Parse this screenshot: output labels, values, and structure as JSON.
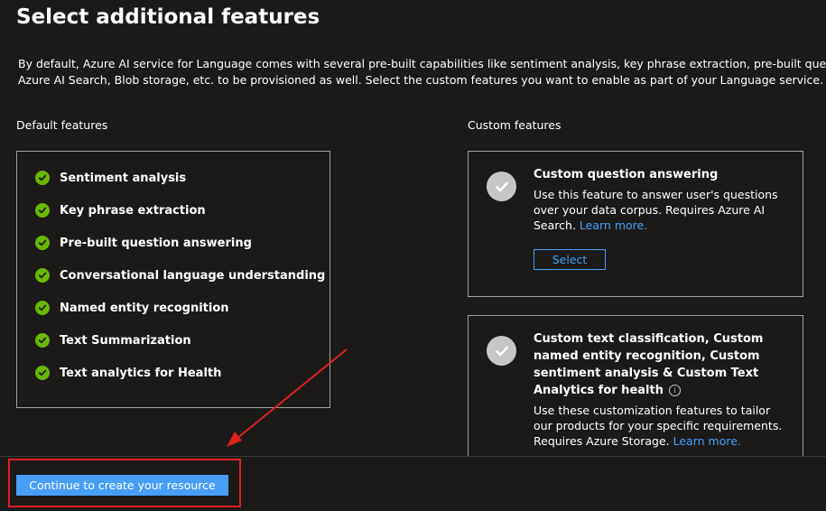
{
  "page": {
    "title": "Select additional features",
    "more_icon": "ellipsis-icon",
    "more_glyph": "···",
    "intro_line1": "By default, Azure AI service for Language comes with several pre-built capabilities like sentiment analysis, key phrase extraction, pre-built question answering",
    "intro_line2": "Azure AI Search, Blob storage, etc. to be provisioned as well. Select the custom features you want to enable as part of your Language service."
  },
  "default_features": {
    "label": "Default features",
    "icon": "green-check-icon",
    "items": [
      "Sentiment analysis",
      "Key phrase extraction",
      "Pre-built question answering",
      "Conversational language understanding",
      "Named entity recognition",
      "Text Summarization",
      "Text analytics for Health"
    ]
  },
  "custom_features": {
    "label": "Custom features",
    "cards": [
      {
        "icon": "grey-check-icon",
        "title": "Custom question answering",
        "desc_line1": "Use this feature to answer user's questions",
        "desc_line2": "over your data corpus. Requires Azure AI",
        "desc_line3_prefix": "Search.",
        "link": "Learn more.",
        "button": "Select"
      },
      {
        "icon": "grey-check-icon",
        "title_line1": "Custom text classification, Custom",
        "title_line2": "named entity recognition, Custom",
        "title_line3": "sentiment analysis & Custom Text",
        "title_line4": "Analytics for health",
        "info_icon": "info-icon",
        "info_glyph": "i",
        "desc_line1": "Use these customization features to tailor",
        "desc_line2": "our products for your specific requirements.",
        "desc_line3_prefix": "Requires Azure Storage.",
        "link": "Learn more."
      }
    ]
  },
  "footer": {
    "primary_button": "Continue to create your resource"
  },
  "colors": {
    "background": "#1b1a19",
    "accent": "#479ef5",
    "success": "#6bb700",
    "annotation": "#e01f1f"
  }
}
